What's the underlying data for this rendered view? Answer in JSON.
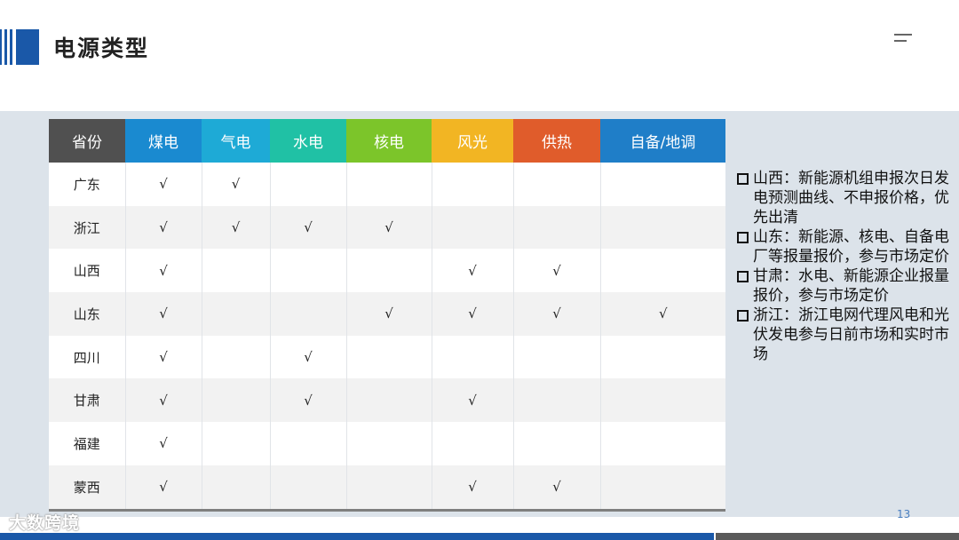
{
  "header": {
    "title": "电源类型"
  },
  "colors": {
    "brand_blue": "#1a58a8",
    "province_header": "#505050",
    "coal": "#1a8ad0",
    "gas": "#1eaad6",
    "hydro": "#20c1a5",
    "nuclear": "#7cc52a",
    "wind_solar": "#f2b523",
    "heating": "#e05c2b",
    "self_peak": "#1f7ec8"
  },
  "icons": [
    "logo-bars",
    "menu-icon",
    "checkbox-icon"
  ],
  "table": {
    "headers": [
      "省份",
      "煤电",
      "气电",
      "水电",
      "核电",
      "风光",
      "供热",
      "自备/地调"
    ],
    "rows": [
      [
        "广东",
        "√",
        "√",
        "",
        "",
        "",
        "",
        ""
      ],
      [
        "浙江",
        "√",
        "√",
        "√",
        "√",
        "",
        "",
        ""
      ],
      [
        "山西",
        "√",
        "",
        "",
        "",
        "√",
        "√",
        ""
      ],
      [
        "山东",
        "√",
        "",
        "",
        "√",
        "√",
        "√",
        "√"
      ],
      [
        "四川",
        "√",
        "",
        "√",
        "",
        "",
        "",
        ""
      ],
      [
        "甘肃",
        "√",
        "",
        "√",
        "",
        "√",
        "",
        ""
      ],
      [
        "福建",
        "√",
        "",
        "",
        "",
        "",
        "",
        ""
      ],
      [
        "蒙西",
        "√",
        "",
        "",
        "",
        "√",
        "√",
        ""
      ]
    ]
  },
  "notes": [
    "山西：新能源机组申报次日发电预测曲线、不申报价格，优先出清",
    "山东：新能源、核电、自备电厂等报量报价，参与市场定价",
    "甘肃：水电、新能源企业报量报价，参与市场定价",
    "浙江：浙江电网代理风电和光伏发电参与日前市场和实时市场"
  ],
  "footer": {
    "watermark": "大数跨境",
    "page_number": "13"
  }
}
